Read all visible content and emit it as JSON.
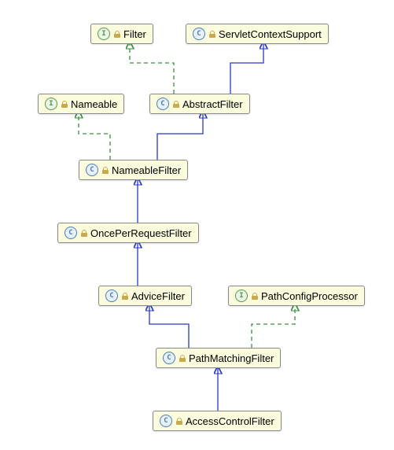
{
  "chart_data": {
    "type": "uml-class-hierarchy",
    "nodes": [
      {
        "id": "Filter",
        "kind": "interface",
        "label": "Filter"
      },
      {
        "id": "ServletContextSupport",
        "kind": "class",
        "label": "ServletContextSupport"
      },
      {
        "id": "Nameable",
        "kind": "interface",
        "label": "Nameable"
      },
      {
        "id": "AbstractFilter",
        "kind": "class",
        "label": "AbstractFilter"
      },
      {
        "id": "NameableFilter",
        "kind": "class",
        "label": "NameableFilter"
      },
      {
        "id": "OncePerRequestFilter",
        "kind": "class",
        "label": "OncePerRequestFilter"
      },
      {
        "id": "AdviceFilter",
        "kind": "class",
        "label": "AdviceFilter"
      },
      {
        "id": "PathConfigProcessor",
        "kind": "interface",
        "label": "PathConfigProcessor"
      },
      {
        "id": "PathMatchingFilter",
        "kind": "class",
        "label": "PathMatchingFilter"
      },
      {
        "id": "AccessControlFilter",
        "kind": "class",
        "label": "AccessControlFilter"
      }
    ],
    "edges": [
      {
        "from": "AbstractFilter",
        "to": "Filter",
        "style": "implements"
      },
      {
        "from": "AbstractFilter",
        "to": "ServletContextSupport",
        "style": "extends"
      },
      {
        "from": "NameableFilter",
        "to": "Nameable",
        "style": "implements"
      },
      {
        "from": "NameableFilter",
        "to": "AbstractFilter",
        "style": "extends"
      },
      {
        "from": "OncePerRequestFilter",
        "to": "NameableFilter",
        "style": "extends"
      },
      {
        "from": "AdviceFilter",
        "to": "OncePerRequestFilter",
        "style": "extends"
      },
      {
        "from": "PathMatchingFilter",
        "to": "AdviceFilter",
        "style": "extends"
      },
      {
        "from": "PathMatchingFilter",
        "to": "PathConfigProcessor",
        "style": "implements"
      },
      {
        "from": "AccessControlFilter",
        "to": "PathMatchingFilter",
        "style": "extends"
      }
    ]
  },
  "colors": {
    "extends": "#2838c8",
    "implements": "#3a9040"
  }
}
